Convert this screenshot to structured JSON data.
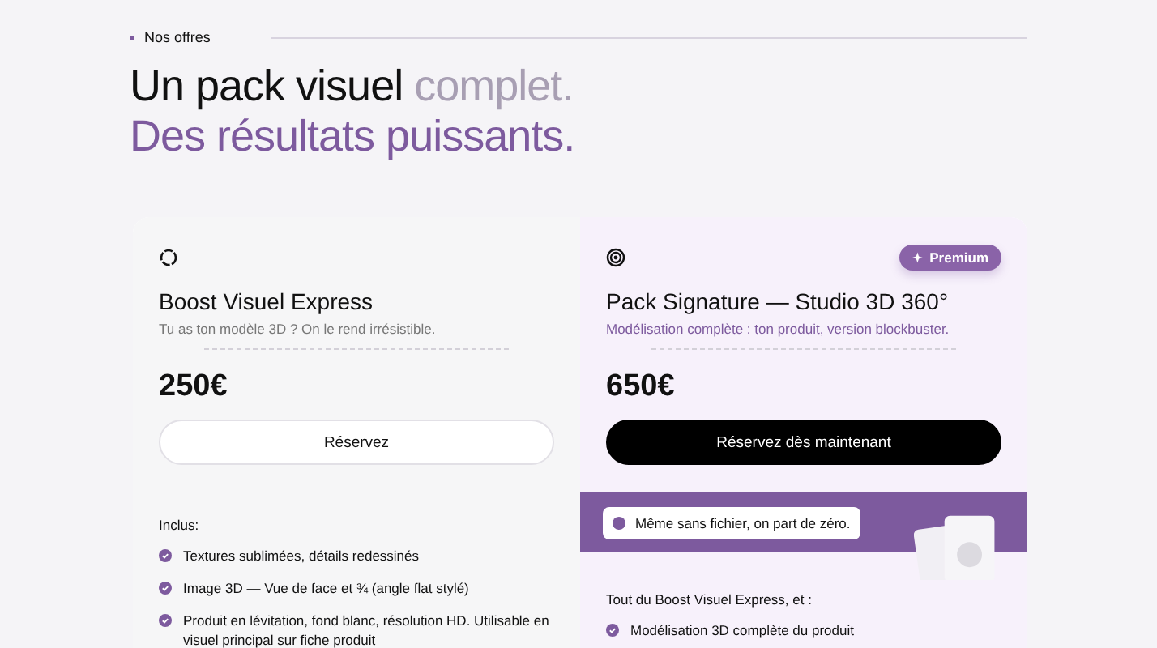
{
  "section": {
    "eyebrow": "Nos offres"
  },
  "headline": {
    "line1": "Un pack visuel",
    "line1_muted": "complet.",
    "line2": "Des résultats puissants."
  },
  "plans": [
    {
      "kind": "express",
      "highlighted": false,
      "name": "Boost Visuel Express",
      "tagline": "Tu as ton modèle 3D ? On le rend irrésistible.",
      "price": "250€",
      "button": "Réservez",
      "includes_label": "Inclus:",
      "features": [
        "Textures sublimées, détails redessinés",
        "Image 3D — Vue de face et ¾ (angle flat stylé)",
        "Produit en lévitation, fond blanc, résolution HD. Utilisable en visuel principal sur fiche produit"
      ]
    },
    {
      "kind": "signature",
      "highlighted": true,
      "badge": "Premium",
      "name": "Pack Signature — Studio 3D 360°",
      "tagline": "Modélisation complète : ton produit, version blockbuster.",
      "price": "650€",
      "button": "Réservez dès maintenant",
      "banner": "Même sans fichier, on part de zéro.",
      "includes_label": "Tout du Boost Visuel Express, et :",
      "features": [
        "Modélisation 3D complète du produit"
      ]
    }
  ]
}
